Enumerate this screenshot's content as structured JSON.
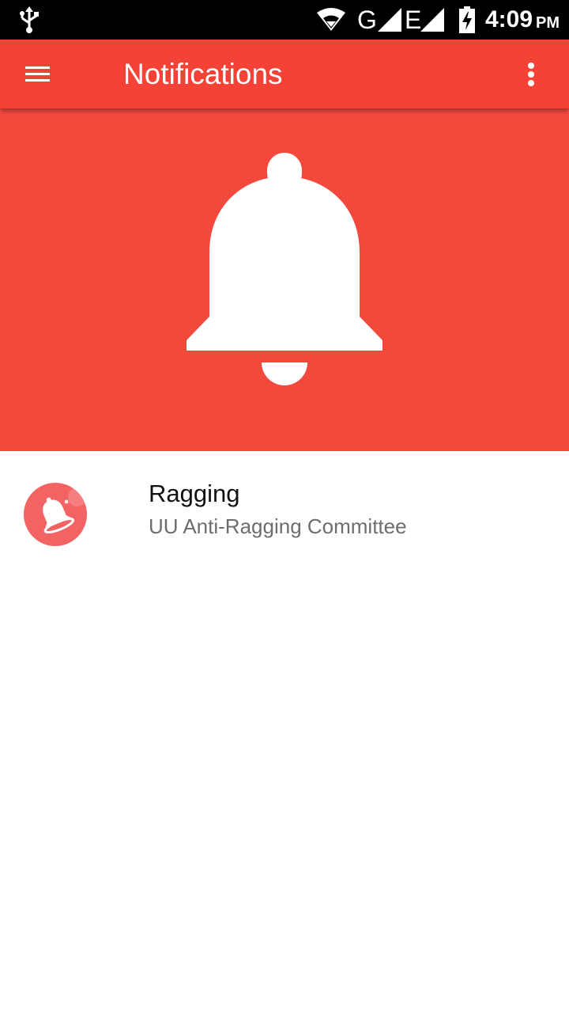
{
  "status_bar": {
    "network_g": "G",
    "network_e": "E",
    "time": "4:09",
    "ampm": "PM",
    "icons": [
      "usb-icon",
      "wifi-icon",
      "signal-icon",
      "battery-charging-icon"
    ]
  },
  "app_bar": {
    "title": "Notifications",
    "background": "#f44237",
    "icons": [
      "menu-icon",
      "more-vert-icon"
    ]
  },
  "hero": {
    "background": "#f3493d",
    "icon": "bell-icon"
  },
  "notifications": [
    {
      "title": "Ragging",
      "subtitle": "UU Anti-Ragging Committee",
      "avatar_color": "#f36363",
      "icon": "bell-icon"
    }
  ]
}
